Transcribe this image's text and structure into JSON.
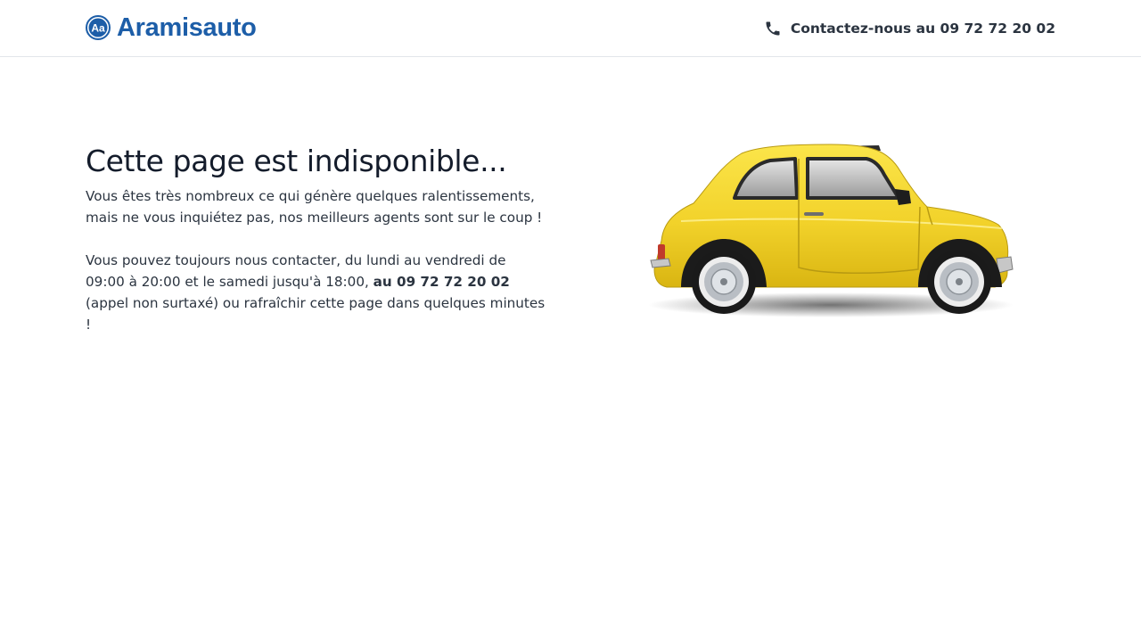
{
  "header": {
    "logo_text": "Aramisauto",
    "logo_mark_text": "Aa",
    "contact_label": "Contactez-nous au 09 72 72 20 02",
    "brand_color": "#1d5ea8"
  },
  "main": {
    "title": "Cette page est indisponible...",
    "paragraph1": "Vous êtes très nombreux ce qui génère quelques ralentissements, mais ne vous inquiétez pas, nos meilleurs agents sont sur le coup !",
    "paragraph2_part1": "Vous pouvez toujours nous contacter, du lundi au vendredi de 09:00 à 20:00 et le samedi jusqu'à 18:00, ",
    "paragraph2_phone": "au 09 72 72 20 02",
    "paragraph2_part2": " (appel non surtaxé) ou rafraîchir cette page dans quelques minutes !"
  },
  "icons": {
    "logo": "aramisauto-logo-icon",
    "phone": "phone-icon",
    "illustration": "yellow-car-illustration"
  },
  "colors": {
    "car_body": "#f2d22a",
    "text": "#2b3440",
    "title": "#141c2b",
    "divider": "#e2e5ea"
  }
}
